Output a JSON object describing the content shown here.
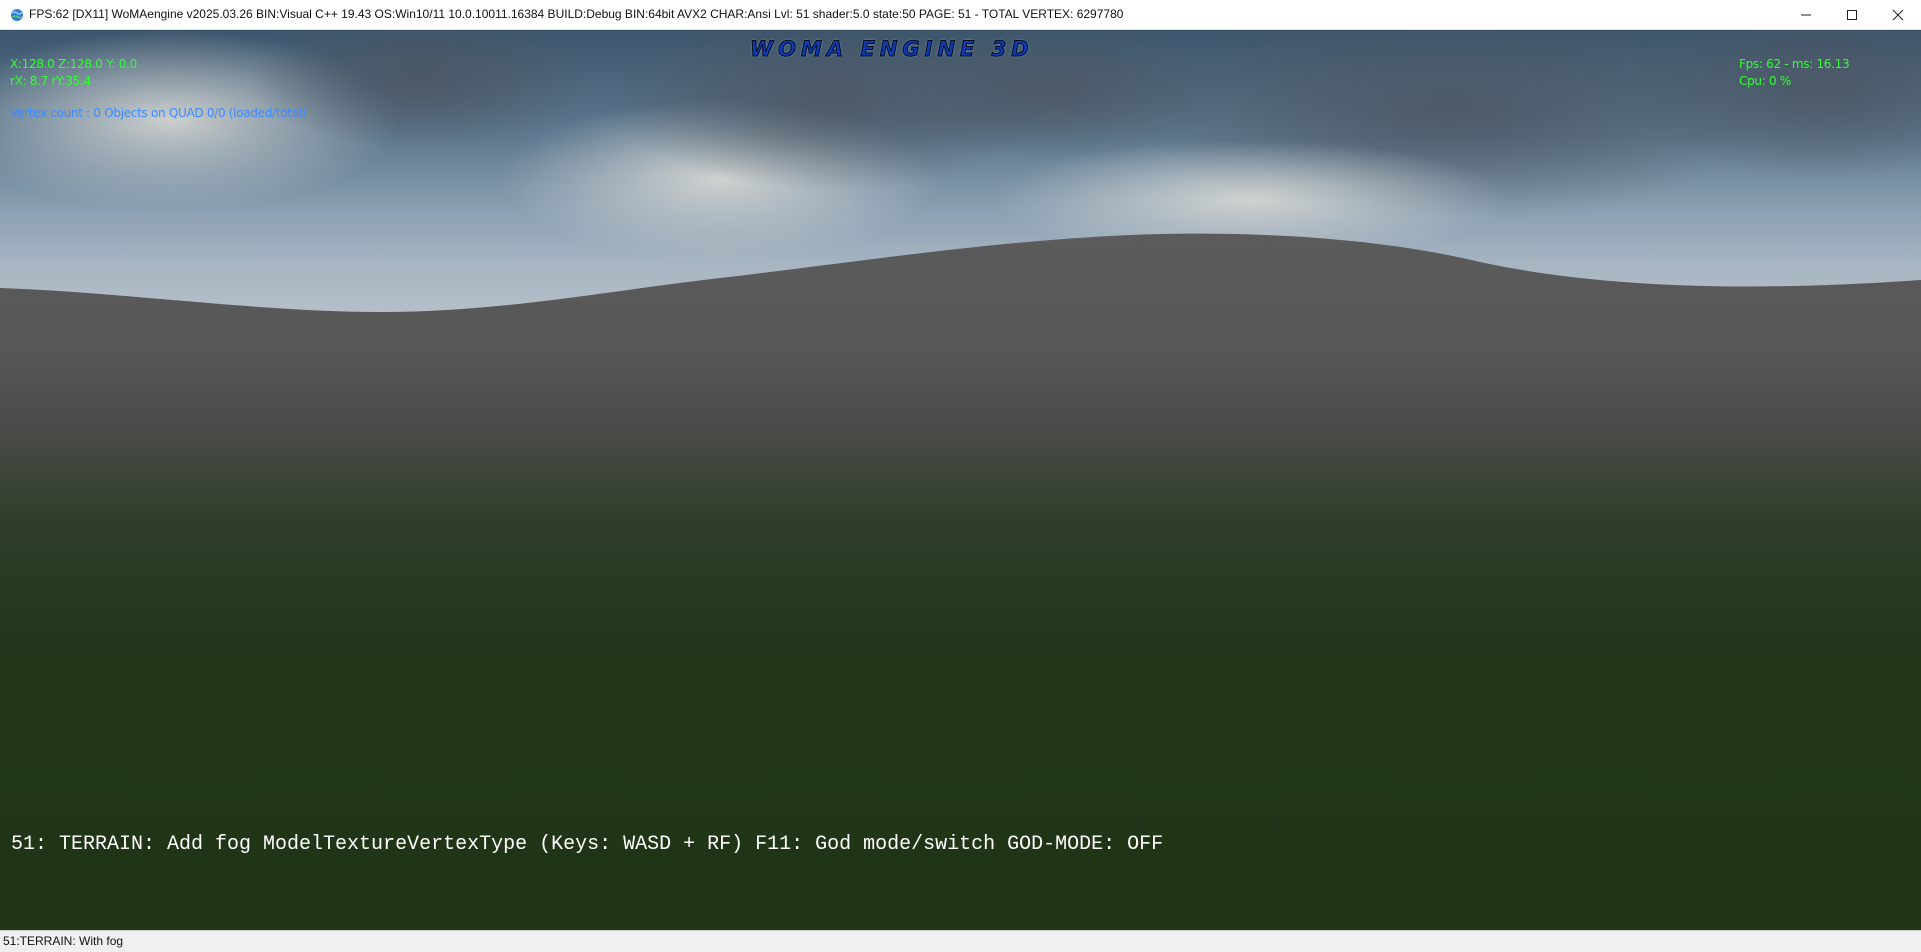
{
  "window": {
    "title": "FPS:62 [DX11] WoMAengine v2025.03.26 BIN:Visual C++ 19.43 OS:Win10/11 10.0.10011.16384 BUILD:Debug BIN:64bit AVX2 CHAR:Ansi Lvl: 51 shader:5.0 state:50 PAGE: 51 - TOTAL VERTEX: 6297780",
    "icon": "globe-icon",
    "controls": [
      "minimize-icon",
      "maximize-icon",
      "close-icon"
    ]
  },
  "hud": {
    "logo": "WOMA ENGINE 3D",
    "position": "X:128.0 Z:128.0 Y: 0.0",
    "rotation": "rX: 8.7 rY:35.4",
    "vertex_count": "Vertex count : 0 Objects on QUAD 0/0 (loaded/total)",
    "fps": "Fps: 62 - ms: 16.13",
    "cpu": "Cpu: 0 %",
    "colors": {
      "green": "#33ff33",
      "blue": "#3a8bff"
    }
  },
  "console": {
    "line": "51: TERRAIN: Add fog ModelTextureVertexType (Keys: WASD + RF) F11: God mode/switch GOD-MODE: OFF"
  },
  "statusbar": {
    "text": "51:TERRAIN: With fog"
  }
}
